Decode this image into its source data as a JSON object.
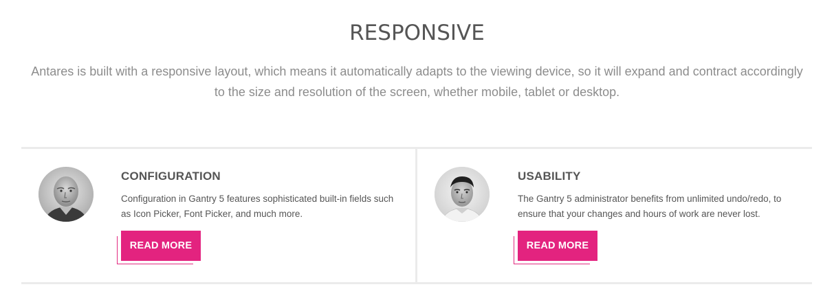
{
  "section": {
    "title": "RESPONSIVE",
    "description": "Antares is built with a responsive layout, which means it automatically adapts to the viewing device, so it will expand and contract accordingly to the size and resolution of the screen, whether mobile, tablet or desktop."
  },
  "cards": [
    {
      "title": "CONFIGURATION",
      "text": "Configuration in Gantry 5 features sophisticated built-in fields such as Icon Picker, Font Picker, and much more.",
      "button_label": "READ MORE",
      "avatar": "grayscale portrait of bald man"
    },
    {
      "title": "USABILITY",
      "text": "The Gantry 5 administrator benefits from unlimited undo/redo, to ensure that your changes and hours of work are never lost.",
      "button_label": "READ MORE",
      "avatar": "grayscale portrait of young man"
    }
  ],
  "colors": {
    "accent": "#e3237f",
    "heading": "#555555",
    "intro_text": "#8c8c8c",
    "border": "#ebebeb"
  }
}
